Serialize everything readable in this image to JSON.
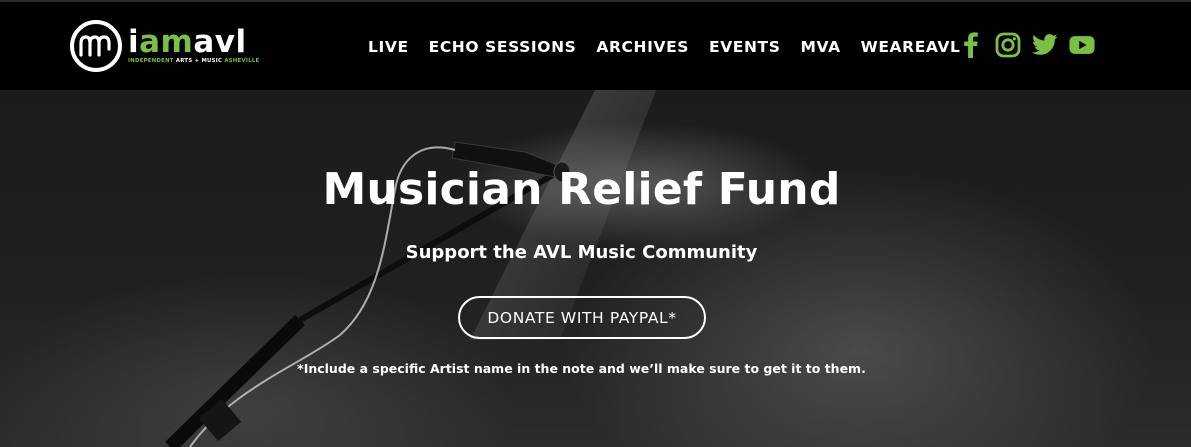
{
  "header": {
    "logo": {
      "word_prefix": "i",
      "word_green": "am",
      "word_suffix": "avl",
      "tagline_a": "INDEPENDENT ",
      "tagline_b": "ARTS",
      "tagline_c": " + ",
      "tagline_d": "MUSIC",
      "tagline_e": " ASHEVILLE"
    },
    "nav": [
      {
        "label": "LIVE"
      },
      {
        "label": "ECHO SESSIONS"
      },
      {
        "label": "ARCHIVES"
      },
      {
        "label": "EVENTS"
      },
      {
        "label": "MVA"
      },
      {
        "label": "WEAREAVL"
      }
    ],
    "social": [
      {
        "icon": "facebook-icon"
      },
      {
        "icon": "instagram-icon"
      },
      {
        "icon": "twitter-icon"
      },
      {
        "icon": "youtube-icon"
      }
    ]
  },
  "hero": {
    "title": "Musician Relief Fund",
    "subtitle": "Support the AVL Music Community",
    "donate_label": "DONATE WITH PAYPAL*",
    "note": "*Include a specific Artist name in the note and we’ll make sure to get it to them."
  },
  "colors": {
    "accent": "#7ac143",
    "header_bg": "#000000",
    "text": "#ffffff"
  }
}
